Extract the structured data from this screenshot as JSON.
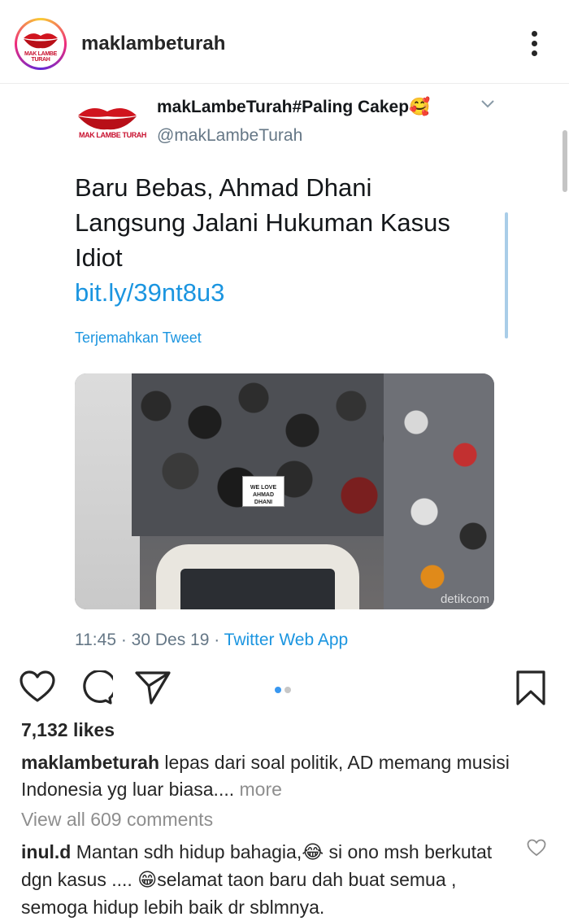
{
  "post": {
    "username": "maklambeturah",
    "avatar_brand": "MAK LAMBE TURAH"
  },
  "tweet": {
    "display_name": "makLambeTurah#Paling Cakep",
    "name_emoji": "🥰",
    "handle": "@makLambeTurah",
    "logo_brand": "MAK LAMBE TURAH",
    "text_lines": [
      "Baru Bebas, Ahmad Dhani",
      "Langsung Jalani Hukuman Kasus",
      "Idiot"
    ],
    "link": "bit.ly/39nt8u3",
    "translate": "Terjemahkan Tweet",
    "photo_sign": "WE LOVE AHMAD DHANI",
    "photo_watermark": "detikcom",
    "timestamp": "11:45 · 30 Des 19 · ",
    "source_app": "Twitter Web App"
  },
  "actions": {
    "icons": [
      "heart-icon",
      "comment-icon",
      "share-icon",
      "bookmark-icon"
    ],
    "carousel_total": 2,
    "carousel_active": 1,
    "accent": "#3897f0"
  },
  "likes": "7,132 likes",
  "caption": {
    "user": "maklambeturah",
    "text": "lepas dari soal politik, AD memang musisi Indonesia yg luar biasa....",
    "more": "more"
  },
  "view_all": "View all 609 comments",
  "comment": {
    "user": "inul.d",
    "part1": "Mantan sdh hidup bahagia,",
    "emoji1": "😂",
    "part2": " si ono msh berkutat dgn kasus .... ",
    "emoji2": "😁",
    "part3": "selamat taon baru dah buat semua , semoga hidup lebih baik dr sblmnya."
  }
}
